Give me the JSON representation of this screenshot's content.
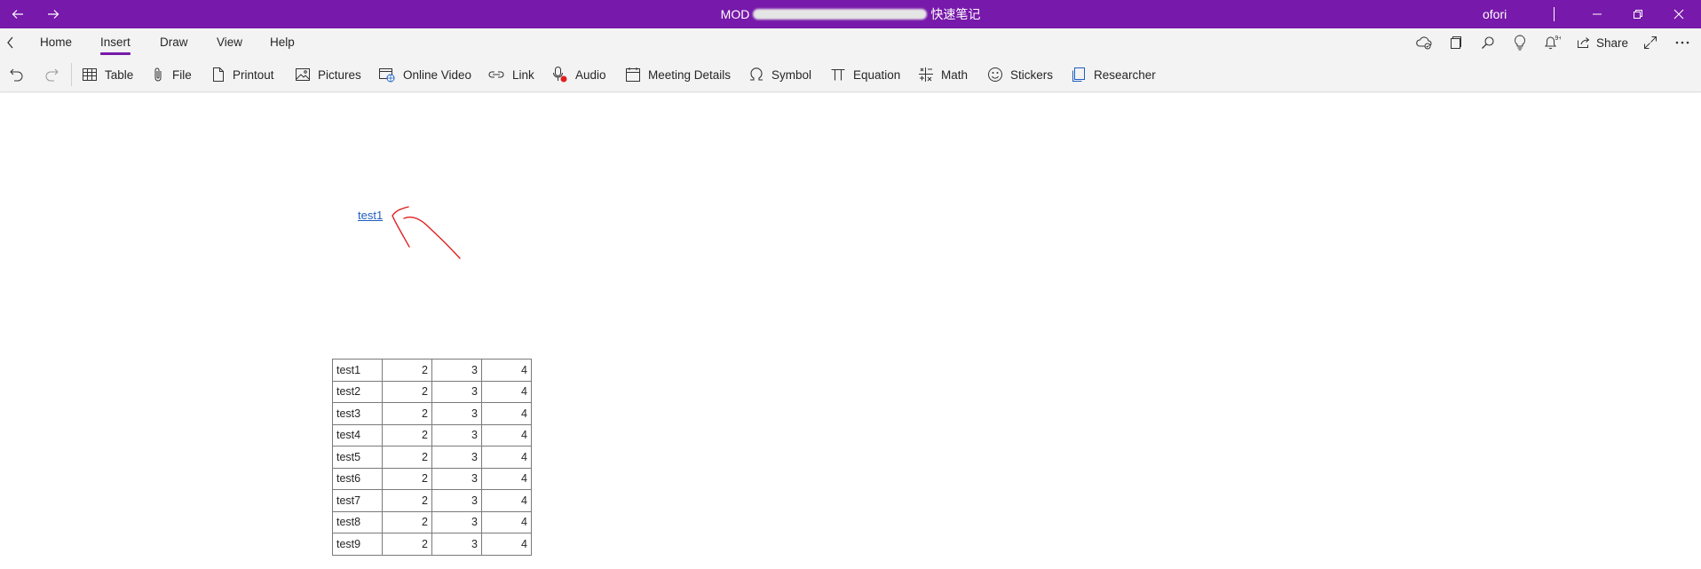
{
  "titlebar": {
    "title_prefix": "MOD",
    "title_suffix": "快速笔记",
    "user": "ofori",
    "background": "#7719AA"
  },
  "nav": {
    "back_icon": "arrow-left-icon",
    "forward_icon": "arrow-right-icon"
  },
  "tabs": [
    {
      "label": "Home"
    },
    {
      "label": "Insert",
      "active": true
    },
    {
      "label": "Draw"
    },
    {
      "label": "View"
    },
    {
      "label": "Help"
    }
  ],
  "toolbar_right": {
    "share_label": "Share"
  },
  "ribbon": {
    "items": [
      {
        "label": "Table",
        "icon": "table-icon"
      },
      {
        "label": "File",
        "icon": "paperclip-icon"
      },
      {
        "label": "Printout",
        "icon": "document-icon"
      },
      {
        "label": "Pictures",
        "icon": "picture-icon"
      },
      {
        "label": "Online Video",
        "icon": "online-video-icon"
      },
      {
        "label": "Link",
        "icon": "link-icon"
      },
      {
        "label": "Audio",
        "icon": "audio-record-icon"
      },
      {
        "label": "Meeting Details",
        "icon": "calendar-icon"
      },
      {
        "label": "Symbol",
        "icon": "omega-icon"
      },
      {
        "label": "Equation",
        "icon": "pi-icon"
      },
      {
        "label": "Math",
        "icon": "math-icon"
      },
      {
        "label": "Stickers",
        "icon": "smiley-icon"
      },
      {
        "label": "Researcher",
        "icon": "researcher-icon"
      }
    ]
  },
  "page": {
    "link_text": "test1",
    "ink_color": "#e02020",
    "table": [
      [
        "test1",
        "2",
        "3",
        "4"
      ],
      [
        "test2",
        "2",
        "3",
        "4"
      ],
      [
        "test3",
        "2",
        "3",
        "4"
      ],
      [
        "test4",
        "2",
        "3",
        "4"
      ],
      [
        "test5",
        "2",
        "3",
        "4"
      ],
      [
        "test6",
        "2",
        "3",
        "4"
      ],
      [
        "test7",
        "2",
        "3",
        "4"
      ],
      [
        "test8",
        "2",
        "3",
        "4"
      ],
      [
        "test9",
        "2",
        "3",
        "4"
      ]
    ]
  }
}
